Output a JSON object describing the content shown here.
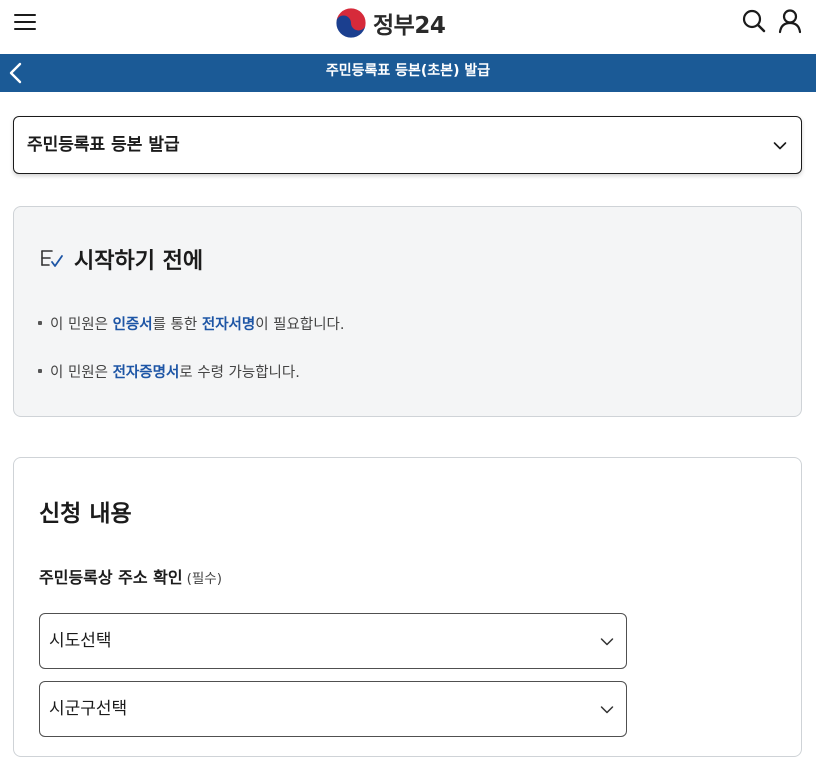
{
  "header": {
    "logo_text": "정부24"
  },
  "navbar": {
    "title": "주민등록표 등본(초본) 발급"
  },
  "document_type_select": {
    "selected": "주민등록표 등본 발급"
  },
  "notice": {
    "title": "시작하기 전에",
    "items": [
      {
        "pre": "이 민원은 ",
        "hl1": "인증서",
        "mid": "를 통한 ",
        "hl2": "전자서명",
        "post": "이 필요합니다."
      },
      {
        "pre": "이 민원은 ",
        "hl1": "전자증명서",
        "post": "로 수령 가능합니다."
      }
    ]
  },
  "application": {
    "title": "신청 내용",
    "address_label": "주민등록상 주소 확인",
    "required_label": "(필수)",
    "sido_select": "시도선택",
    "sigungu_select": "시군구선택"
  },
  "colors": {
    "navbar": "#1b5a96",
    "highlight": "#1d55a5"
  }
}
